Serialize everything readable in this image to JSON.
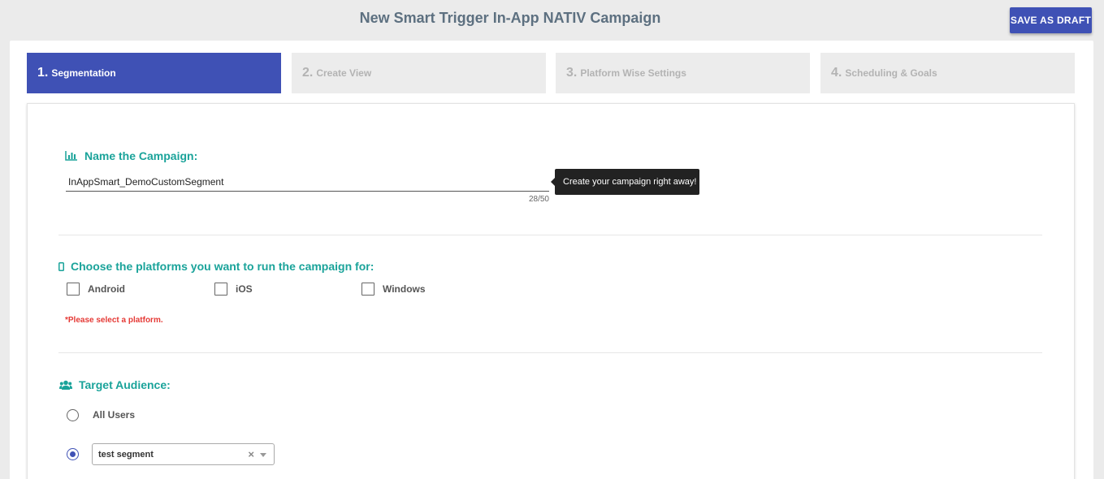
{
  "header": {
    "title": "New Smart Trigger In-App NATIV Campaign",
    "save_label": "SAVE AS DRAFT"
  },
  "steps": [
    {
      "num": "1.",
      "label": "Segmentation",
      "active": true
    },
    {
      "num": "2.",
      "label": "Create View",
      "active": false
    },
    {
      "num": "3.",
      "label": "Platform Wise Settings",
      "active": false
    },
    {
      "num": "4.",
      "label": "Scheduling & Goals",
      "active": false
    }
  ],
  "campaign_name": {
    "title": "Name the Campaign:",
    "icon": "bar-chart-icon",
    "value": "InAppSmart_DemoCustomSegment",
    "counter": "28/50",
    "tooltip": "Create your campaign right away!"
  },
  "platforms": {
    "title": "Choose the platforms you want to run the campaign for:",
    "icon": "mobile-icon",
    "options": [
      "Android",
      "iOS",
      "Windows"
    ],
    "error": "*Please select a platform."
  },
  "audience": {
    "title": "Target Audience:",
    "icon": "users-icon",
    "all_users_label": "All Users",
    "selected_segment": "test segment",
    "clear_symbol": "×"
  },
  "colors": {
    "accent": "#3f51b5",
    "section_title": "#1aa39a",
    "error": "#e53935",
    "page_title": "#5d7080"
  }
}
